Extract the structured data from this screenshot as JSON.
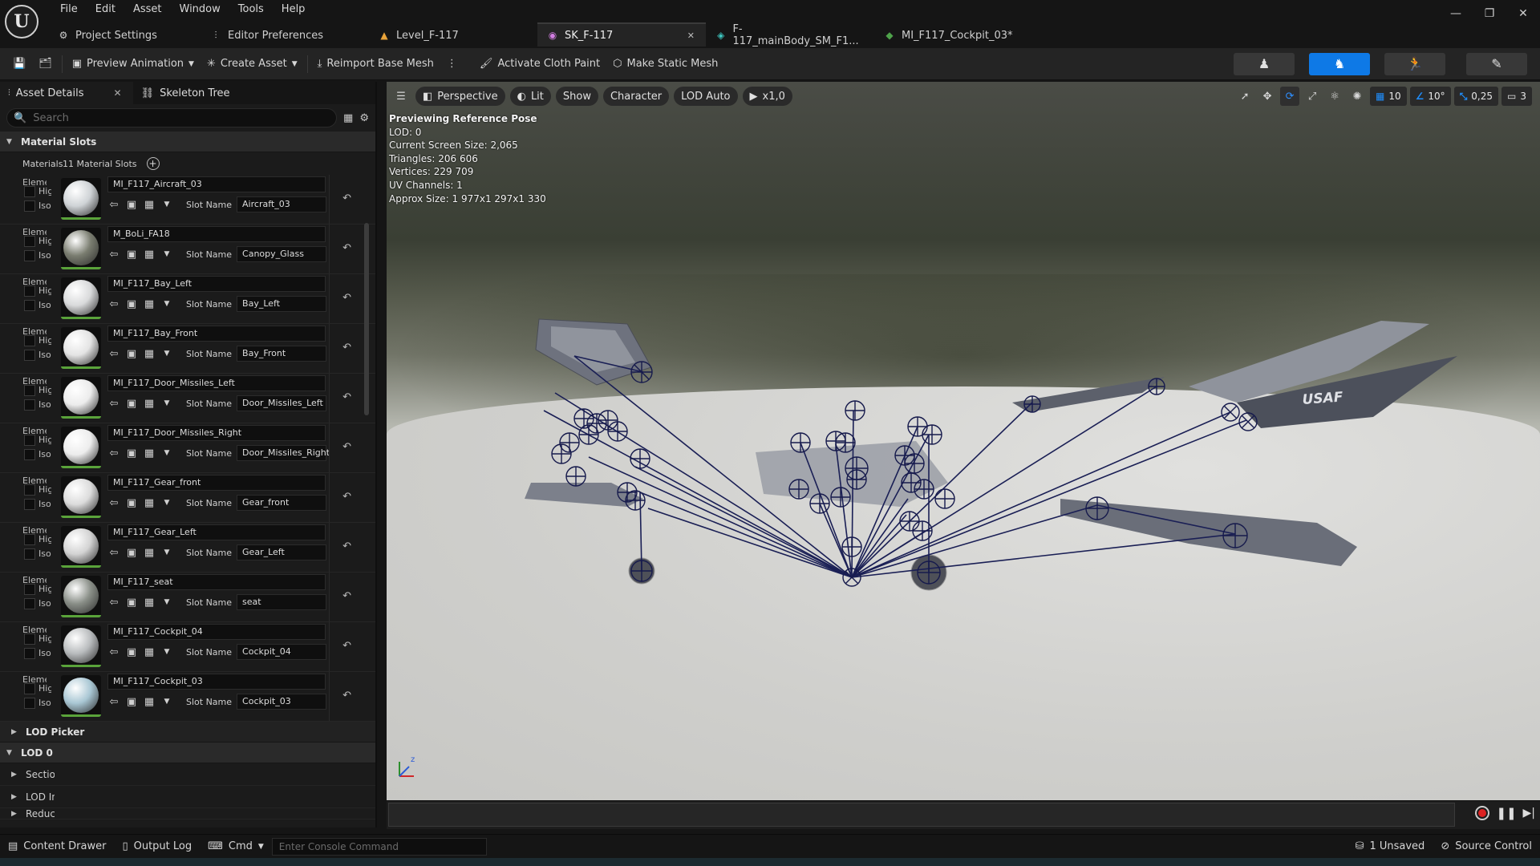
{
  "app": {
    "logo": "U",
    "menu": [
      "File",
      "Edit",
      "Asset",
      "Window",
      "Tools",
      "Help"
    ]
  },
  "tabs": [
    {
      "label": "Project Settings",
      "icon": "gear-icon"
    },
    {
      "label": "Editor Preferences",
      "icon": "sliders-icon"
    },
    {
      "label": "Level_F-117",
      "icon": "level-icon"
    },
    {
      "label": "SK_F-117",
      "icon": "skeleton-icon",
      "active": true,
      "close": "✕"
    },
    {
      "label": "F-117_mainBody_SM_F1...",
      "icon": "mesh-icon"
    },
    {
      "label": "MI_F117_Cockpit_03*",
      "icon": "material-icon"
    }
  ],
  "toolbar": {
    "preview_animation": "Preview Animation",
    "create_asset": "Create Asset",
    "reimport": "Reimport Base Mesh",
    "cloth": "Activate Cloth Paint",
    "static_mesh": "Make Static Mesh"
  },
  "panel": {
    "tab_details": "Asset Details",
    "tab_close": "✕",
    "tab_skeleton": "Skeleton Tree",
    "search_placeholder": "Search",
    "section_material_slots": "Material Slots",
    "materials_label": "Materials",
    "materials_count": "11 Material Slots",
    "elem_label": "Element",
    "hig_label": "Highlight",
    "iso_label": "Isolate",
    "slot_name_label": "Slot Name",
    "lod_picker": "LOD Picker",
    "lod0": "LOD 0",
    "sections": "Sections",
    "lod_info": "LOD Info",
    "reduction": "Reduction"
  },
  "materials": [
    {
      "name": "MI_F117_Aircraft_03",
      "slot": "Aircraft_03",
      "tone": "#cfd3d6"
    },
    {
      "name": "M_BoLi_FA18",
      "slot": "Canopy_Glass",
      "tone": "#7a7d70"
    },
    {
      "name": "MI_F117_Bay_Left",
      "slot": "Bay_Left",
      "tone": "#d9dadb"
    },
    {
      "name": "MI_F117_Bay_Front",
      "slot": "Bay_Front",
      "tone": "#e4e4e4"
    },
    {
      "name": "MI_F117_Door_Missiles_Left",
      "slot": "Door_Missiles_Left",
      "tone": "#ececec"
    },
    {
      "name": "MI_F117_Door_Missiles_Right",
      "slot": "Door_Missiles_Right",
      "tone": "#ededed"
    },
    {
      "name": "MI_F117_Gear_front",
      "slot": "Gear_front",
      "tone": "#dcdcdc"
    },
    {
      "name": "MI_F117_Gear_Left",
      "slot": "Gear_Left",
      "tone": "#d3d3d3"
    },
    {
      "name": "MI_F117_seat",
      "slot": "seat",
      "tone": "#8a8f88"
    },
    {
      "name": "MI_F117_Cockpit_04",
      "slot": "Cockpit_04",
      "tone": "#b9bcbe"
    },
    {
      "name": "MI_F117_Cockpit_03",
      "slot": "Cockpit_03",
      "tone": "#a9c7d4"
    }
  ],
  "viewport": {
    "perspective": "Perspective",
    "lit": "Lit",
    "show": "Show",
    "character": "Character",
    "lod": "LOD Auto",
    "speed": "x1,0",
    "grid": "10",
    "angle": "10°",
    "scale": "0,25",
    "camera": "3",
    "info_head": "Previewing Reference Pose",
    "info": [
      "LOD: 0",
      "Current Screen Size: 2,065",
      "Triangles: 206 606",
      "Vertices: 229 709",
      "UV Channels: 1",
      "Approx Size: 1 977x1 297x1 330"
    ],
    "wing_text": "USAF"
  },
  "status": {
    "content_drawer": "Content Drawer",
    "output_log": "Output Log",
    "cmd": "Cmd",
    "console_placeholder": "Enter Console Command",
    "unsaved": "1 Unsaved",
    "source_control": "Source Control"
  }
}
